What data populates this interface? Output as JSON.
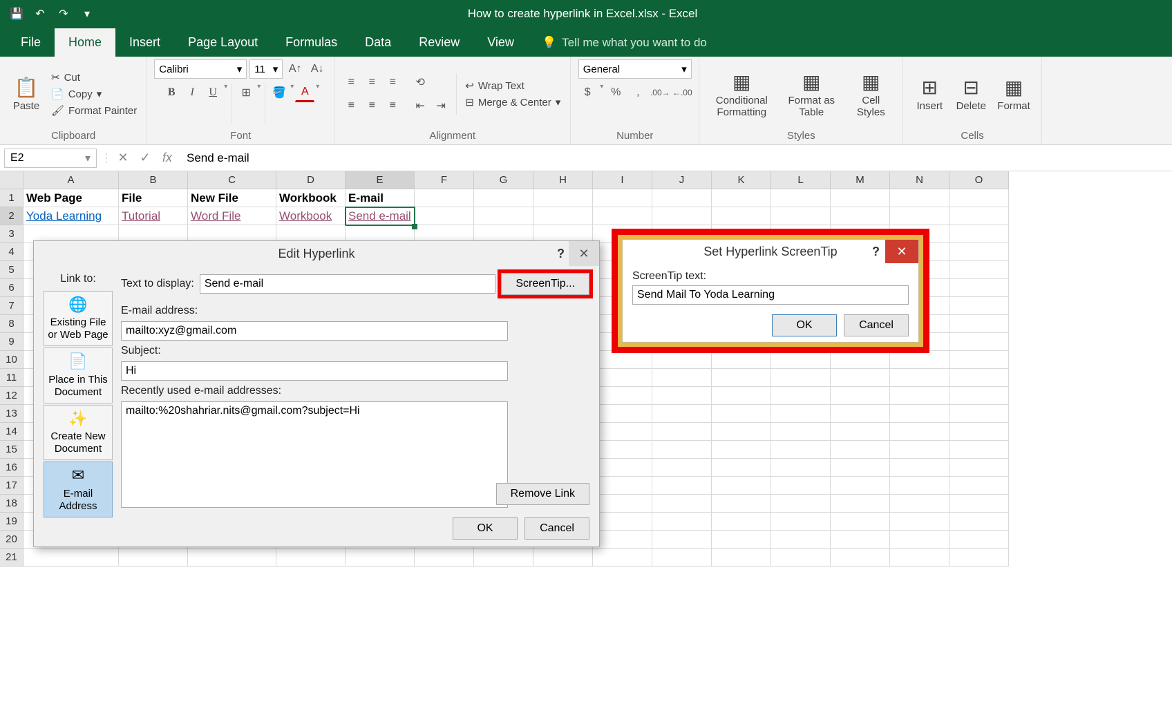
{
  "title": "How to create hyperlink in Excel.xlsx - Excel",
  "tabs": [
    "File",
    "Home",
    "Insert",
    "Page Layout",
    "Formulas",
    "Data",
    "Review",
    "View"
  ],
  "tellme": "Tell me what you want to do",
  "ribbon": {
    "clipboard": {
      "paste": "Paste",
      "cut": "Cut",
      "copy": "Copy",
      "fp": "Format Painter",
      "label": "Clipboard"
    },
    "font": {
      "name": "Calibri",
      "size": "11",
      "label": "Font"
    },
    "alignment": {
      "wrap": "Wrap Text",
      "merge": "Merge & Center",
      "label": "Alignment"
    },
    "number": {
      "format": "General",
      "label": "Number"
    },
    "styles": {
      "cf": "Conditional Formatting",
      "fat": "Format as Table",
      "cs": "Cell Styles",
      "label": "Styles"
    },
    "cells": {
      "ins": "Insert",
      "del": "Delete",
      "fmt": "Format",
      "label": "Cells"
    }
  },
  "namebox": "E2",
  "formula": "Send e-mail",
  "columns": [
    "A",
    "B",
    "C",
    "D",
    "E",
    "F",
    "G",
    "H",
    "I",
    "J",
    "K",
    "L",
    "M",
    "N",
    "O"
  ],
  "headers": {
    "A": "Web Page",
    "B": "File",
    "C": "New File",
    "D": "Workbook",
    "E": "E-mail"
  },
  "row2": {
    "A": "Yoda Learning",
    "B": "Tutorial",
    "C": "Word File",
    "D": "Workbook",
    "E": "Send e-mail"
  },
  "hyperlink": {
    "title": "Edit Hyperlink",
    "linkto": "Link to:",
    "ttd": "Text to display:",
    "ttd_val": "Send e-mail",
    "screentip": "ScreenTip...",
    "email_lbl": "E-mail address:",
    "email_val": "mailto:xyz@gmail.com",
    "subj_lbl": "Subject:",
    "subj_val": "Hi",
    "recent_lbl": "Recently used e-mail addresses:",
    "recent_val": "mailto:%20shahriar.nits@gmail.com?subject=Hi",
    "remove": "Remove Link",
    "ok": "OK",
    "cancel": "Cancel",
    "opts": [
      "Existing File or Web Page",
      "Place in This Document",
      "Create New Document",
      "E-mail Address"
    ]
  },
  "screentip": {
    "title": "Set Hyperlink ScreenTip",
    "label": "ScreenTip text:",
    "value": "Send Mail To Yoda Learning",
    "ok": "OK",
    "cancel": "Cancel"
  }
}
